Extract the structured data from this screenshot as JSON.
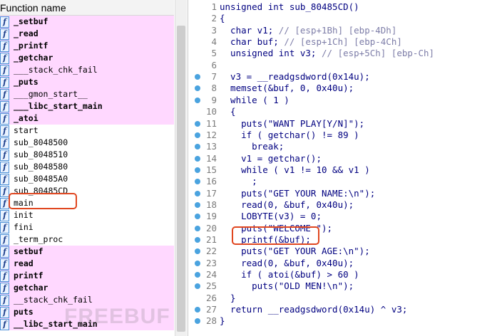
{
  "functions_pane": {
    "header": "Function name",
    "items": [
      {
        "name": "_setbuf",
        "bold": true,
        "lib": true
      },
      {
        "name": "_read",
        "bold": true,
        "lib": true
      },
      {
        "name": "_printf",
        "bold": true,
        "lib": true
      },
      {
        "name": "_getchar",
        "bold": true,
        "lib": true
      },
      {
        "name": "___stack_chk_fail",
        "bold": false,
        "lib": true
      },
      {
        "name": "_puts",
        "bold": true,
        "lib": true
      },
      {
        "name": "___gmon_start__",
        "bold": false,
        "lib": true
      },
      {
        "name": "___libc_start_main",
        "bold": true,
        "lib": true
      },
      {
        "name": "_atoi",
        "bold": true,
        "lib": true
      },
      {
        "name": "start",
        "bold": false,
        "lib": false
      },
      {
        "name": "sub_8048500",
        "bold": false,
        "lib": false
      },
      {
        "name": "sub_8048510",
        "bold": false,
        "lib": false
      },
      {
        "name": "sub_8048580",
        "bold": false,
        "lib": false
      },
      {
        "name": "sub_80485A0",
        "bold": false,
        "lib": false
      },
      {
        "name": "sub_80485CD",
        "bold": false,
        "lib": false,
        "selected": true
      },
      {
        "name": "main",
        "bold": false,
        "lib": false
      },
      {
        "name": "init",
        "bold": false,
        "lib": false
      },
      {
        "name": "fini",
        "bold": false,
        "lib": false
      },
      {
        "name": "_term_proc",
        "bold": false,
        "lib": false
      },
      {
        "name": "setbuf",
        "bold": true,
        "lib": true
      },
      {
        "name": "read",
        "bold": true,
        "lib": true
      },
      {
        "name": "printf",
        "bold": true,
        "lib": true
      },
      {
        "name": "getchar",
        "bold": true,
        "lib": true
      },
      {
        "name": "__stack_chk_fail",
        "bold": false,
        "lib": true
      },
      {
        "name": "puts",
        "bold": true,
        "lib": true
      },
      {
        "name": "__libc_start_main",
        "bold": true,
        "lib": true
      }
    ]
  },
  "code_pane": {
    "lines": [
      {
        "n": "1",
        "text": "unsigned int sub_80485CD()",
        "bp": false
      },
      {
        "n": "2",
        "text": "{",
        "bp": false
      },
      {
        "n": "3",
        "text": "  char v1; // [esp+1Bh] [ebp-4Dh]",
        "bp": false
      },
      {
        "n": "4",
        "text": "  char buf; // [esp+1Ch] [ebp-4Ch]",
        "bp": false
      },
      {
        "n": "5",
        "text": "  unsigned int v3; // [esp+5Ch] [ebp-Ch]",
        "bp": false
      },
      {
        "n": "6",
        "text": "",
        "bp": false
      },
      {
        "n": "7",
        "text": "  v3 = __readgsdword(0x14u);",
        "bp": true
      },
      {
        "n": "8",
        "text": "  memset(&buf, 0, 0x40u);",
        "bp": true
      },
      {
        "n": "9",
        "text": "  while ( 1 )",
        "bp": true
      },
      {
        "n": "10",
        "text": "  {",
        "bp": false
      },
      {
        "n": "11",
        "text": "    puts(\"WANT PLAY[Y/N]\");",
        "bp": true
      },
      {
        "n": "12",
        "text": "    if ( getchar() != 89 )",
        "bp": true
      },
      {
        "n": "13",
        "text": "      break;",
        "bp": true
      },
      {
        "n": "14",
        "text": "    v1 = getchar();",
        "bp": true
      },
      {
        "n": "15",
        "text": "    while ( v1 != 10 && v1 )",
        "bp": true
      },
      {
        "n": "16",
        "text": "      ;",
        "bp": true
      },
      {
        "n": "17",
        "text": "    puts(\"GET YOUR NAME:\\n\");",
        "bp": true
      },
      {
        "n": "18",
        "text": "    read(0, &buf, 0x40u);",
        "bp": true
      },
      {
        "n": "19",
        "text": "    LOBYTE(v3) = 0;",
        "bp": true
      },
      {
        "n": "20",
        "text": "    puts(\"WELCOME \");",
        "bp": true
      },
      {
        "n": "21",
        "text": "    printf(&buf);",
        "bp": true
      },
      {
        "n": "22",
        "text": "    puts(\"GET YOUR AGE:\\n\");",
        "bp": true
      },
      {
        "n": "23",
        "text": "    read(0, &buf, 0x40u);",
        "bp": true
      },
      {
        "n": "24",
        "text": "    if ( atoi(&buf) > 60 )",
        "bp": true
      },
      {
        "n": "25",
        "text": "      puts(\"OLD MEN!\\n\");",
        "bp": true
      },
      {
        "n": "26",
        "text": "  }",
        "bp": false
      },
      {
        "n": "27",
        "text": "  return __readgsdword(0x14u) ^ v3;",
        "bp": true
      },
      {
        "n": "28",
        "text": "}",
        "bp": true
      }
    ]
  },
  "colors": {
    "lib_row_bg": "#ffd8ff",
    "code_text": "#000080",
    "comment": "#7d7da8",
    "breakpoint_dot": "#4aa3df",
    "annotation_box": "#e0461f"
  },
  "watermark": "FREEBUF"
}
